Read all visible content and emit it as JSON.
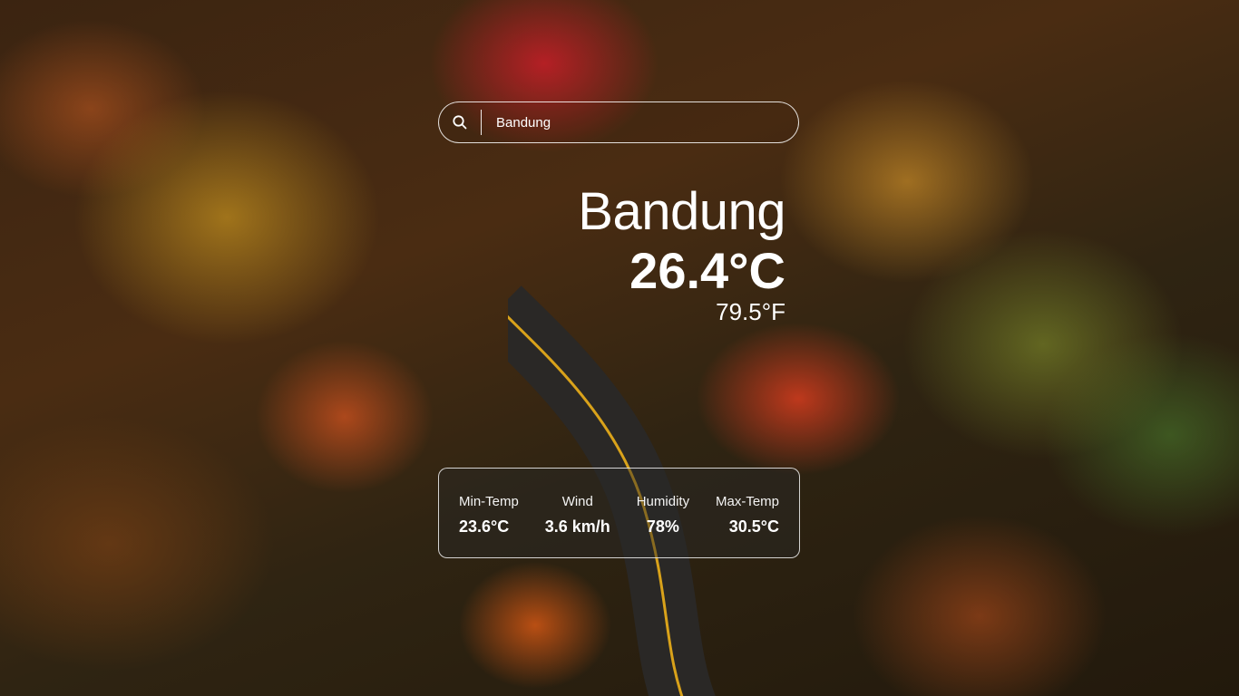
{
  "search": {
    "value": "Bandung",
    "icon": "search-icon"
  },
  "current": {
    "city": "Bandung",
    "temp_c": "26.4°C",
    "temp_f": "79.5°F"
  },
  "details": {
    "min_temp": {
      "label": "Min-Temp",
      "value": "23.6°C"
    },
    "wind": {
      "label": "Wind",
      "value": "3.6 km/h"
    },
    "humidity": {
      "label": "Humidity",
      "value": "78%"
    },
    "max_temp": {
      "label": "Max-Temp",
      "value": "30.5°C"
    }
  },
  "colors": {
    "text": "#ffffff",
    "panel_border": "#ffffff"
  }
}
